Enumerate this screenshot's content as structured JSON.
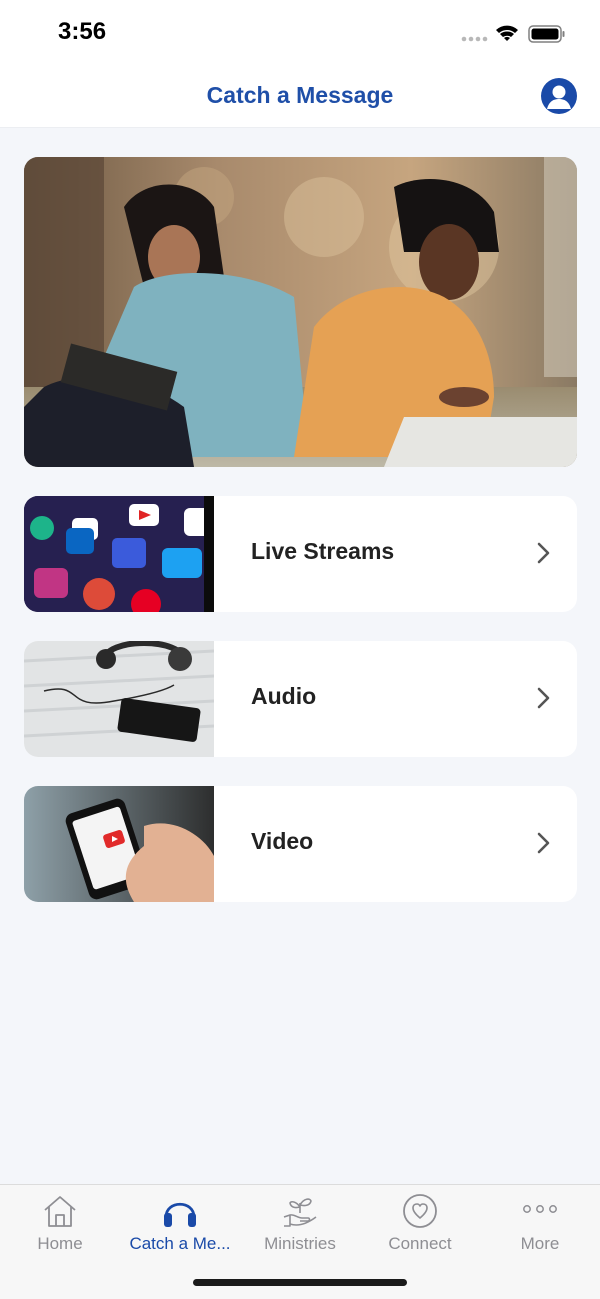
{
  "status_bar": {
    "time": "3:56"
  },
  "header": {
    "title": "Catch a Message"
  },
  "menu": [
    {
      "label": "Live Streams",
      "thumb": "social-media-apps"
    },
    {
      "label": "Audio",
      "thumb": "headphones-phone"
    },
    {
      "label": "Video",
      "thumb": "youtube-phone"
    }
  ],
  "tabs": [
    {
      "label": "Home",
      "icon": "home-icon",
      "active": false
    },
    {
      "label": "Catch a Me...",
      "icon": "headphones-icon",
      "active": true
    },
    {
      "label": "Ministries",
      "icon": "plant-hand-icon",
      "active": false
    },
    {
      "label": "Connect",
      "icon": "heart-circle-icon",
      "active": false
    },
    {
      "label": "More",
      "icon": "more-dots-icon",
      "active": false
    }
  ],
  "colors": {
    "accent": "#1a4aa8",
    "inactive": "#8e8e93",
    "background": "#f4f6fa"
  }
}
